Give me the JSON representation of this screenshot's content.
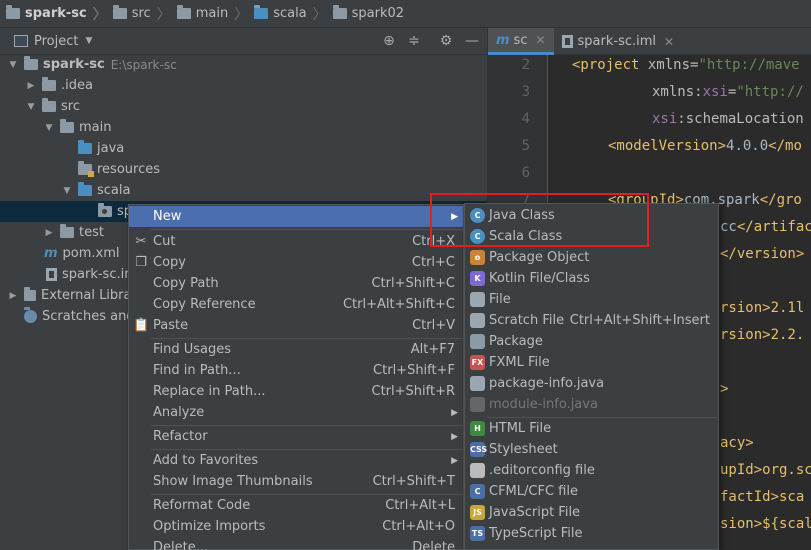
{
  "breadcrumb": [
    "spark-sc",
    "src",
    "main",
    "scala",
    "spark02"
  ],
  "project_panel": {
    "title": "Project",
    "tree": [
      {
        "label": "spark-sc",
        "hint": "E:\\spark-sc"
      },
      {
        "label": ".idea"
      },
      {
        "label": "src"
      },
      {
        "label": "main"
      },
      {
        "label": "java"
      },
      {
        "label": "resources"
      },
      {
        "label": "scala"
      },
      {
        "label": "sp"
      },
      {
        "label": "test"
      },
      {
        "label": "pom.xml"
      },
      {
        "label": "spark-sc.im"
      },
      {
        "label": "External Librar"
      },
      {
        "label": "Scratches and"
      }
    ]
  },
  "editor": {
    "tabs": [
      {
        "icon": "m",
        "label": "sc"
      },
      {
        "label": "spark-sc.iml"
      }
    ],
    "line_numbers": [
      "2",
      "3",
      "4",
      "5",
      "6",
      "7"
    ],
    "code": [
      {
        "tag": "<project ",
        "attr": "xmlns=",
        "val": "\"http://mave"
      },
      {
        "attr": "xmlns:",
        "ns": "xsi",
        "eq": "=",
        "val": "\"http://"
      },
      {
        "ns": "xsi",
        "attr": ":schemaLocation"
      },
      {
        "tag": "<modelVersion>",
        "text": "4.0.0",
        "tag2": "</mo"
      },
      {},
      {
        "tag": "<groupId>",
        "text": "com.spark",
        "tag2": "</gro"
      },
      {
        "text": "cc",
        "tag2": "</artifac"
      },
      {
        "tag2": "</version>"
      },
      {
        "text": "rsion>2.1l"
      },
      {
        "text": "rsion>2.2."
      },
      {
        "tag2": ">"
      },
      {
        "text": "acy>"
      },
      {
        "text": "upId>org.sc"
      },
      {
        "text": "factId>sca"
      },
      {
        "text": "sion>${scal"
      }
    ]
  },
  "context_menu": {
    "items": [
      {
        "label": "New",
        "submenu": true
      },
      {
        "label": "Cut",
        "shortcut": "Ctrl+X",
        "icon": "scissors-icon"
      },
      {
        "label": "Copy",
        "shortcut": "Ctrl+C",
        "icon": "copy-icon"
      },
      {
        "label": "Copy Path",
        "shortcut": "Ctrl+Shift+C"
      },
      {
        "label": "Copy Reference",
        "shortcut": "Ctrl+Alt+Shift+C"
      },
      {
        "label": "Paste",
        "shortcut": "Ctrl+V",
        "icon": "paste-icon"
      },
      {
        "label": "Find Usages",
        "shortcut": "Alt+F7"
      },
      {
        "label": "Find in Path...",
        "shortcut": "Ctrl+Shift+F"
      },
      {
        "label": "Replace in Path...",
        "shortcut": "Ctrl+Shift+R"
      },
      {
        "label": "Analyze",
        "submenu": true
      },
      {
        "label": "Refactor",
        "submenu": true
      },
      {
        "label": "Add to Favorites",
        "submenu": true
      },
      {
        "label": "Show Image Thumbnails",
        "shortcut": "Ctrl+Shift+T"
      },
      {
        "label": "Reformat Code",
        "shortcut": "Ctrl+Alt+L"
      },
      {
        "label": "Optimize Imports",
        "shortcut": "Ctrl+Alt+O"
      },
      {
        "label": "Delete...",
        "shortcut": "Delete"
      }
    ]
  },
  "new_submenu": {
    "items": [
      {
        "label": "Java Class",
        "icon": "java-class-icon",
        "color": "#4a8fc2",
        "glyph": "C"
      },
      {
        "label": "Scala Class",
        "icon": "scala-class-icon",
        "color": "#4a8fc2",
        "glyph": "C"
      },
      {
        "label": "Package Object",
        "icon": "package-object-icon",
        "color": "#c9843a",
        "glyph": "o"
      },
      {
        "label": "Kotlin File/Class",
        "icon": "kotlin-icon",
        "color": "#7f6ad3",
        "glyph": "K"
      },
      {
        "label": "File",
        "icon": "file-icon",
        "color": "#9aa7b0",
        "glyph": ""
      },
      {
        "label": "Scratch File",
        "shortcut": "Ctrl+Alt+Shift+Insert",
        "icon": "scratch-file-icon",
        "color": "#9aa7b0",
        "glyph": ""
      },
      {
        "label": "Package",
        "icon": "package-icon",
        "color": "#8c9aa6",
        "glyph": ""
      },
      {
        "label": "FXML File",
        "icon": "fxml-icon",
        "color": "#c75450",
        "glyph": "FX"
      },
      {
        "label": "package-info.java",
        "icon": "package-info-icon",
        "color": "#9aa7b0",
        "glyph": ""
      },
      {
        "label": "module-info.java",
        "icon": "module-info-icon",
        "color": "#666666",
        "glyph": "",
        "disabled": true
      },
      {
        "label": "HTML File",
        "icon": "html-icon",
        "color": "#3f8a3f",
        "glyph": "H"
      },
      {
        "label": "Stylesheet",
        "icon": "css-icon",
        "color": "#4a6fa5",
        "glyph": "CSS"
      },
      {
        "label": ".editorconfig file",
        "icon": "editorconfig-icon",
        "color": "#bbbbbb",
        "glyph": ""
      },
      {
        "label": "CFML/CFC file",
        "icon": "cfml-icon",
        "color": "#4a6fa5",
        "glyph": "C"
      },
      {
        "label": "JavaScript File",
        "icon": "javascript-icon",
        "color": "#c9a53a",
        "glyph": "JS"
      },
      {
        "label": "TypeScript File",
        "icon": "typescript-icon",
        "color": "#4a6fa5",
        "glyph": "TS"
      }
    ]
  },
  "colors": {
    "selection": "#4b6eaf",
    "annotation_box": "#e02020"
  }
}
